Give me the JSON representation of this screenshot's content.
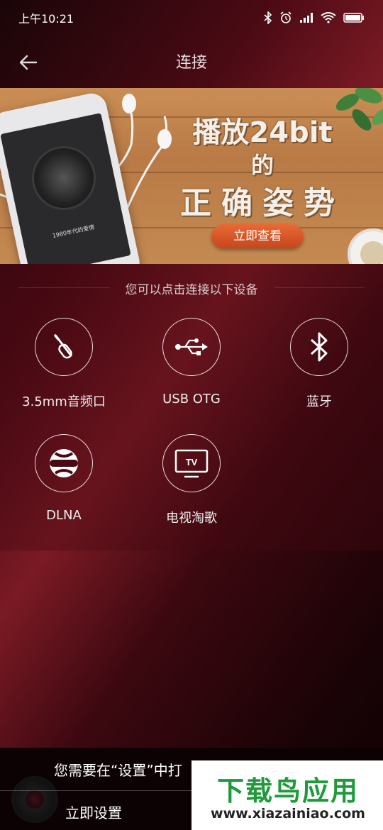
{
  "status_bar": {
    "time": "上午10:21"
  },
  "header": {
    "title": "连接"
  },
  "banner": {
    "line1": "播放24bit",
    "line2": "的",
    "line3": "正确姿势",
    "cta": "立即查看",
    "phone_song": "1980年代的爱情"
  },
  "connect": {
    "hint": "您可以点击连接以下设备",
    "devices": [
      {
        "label": "3.5mm音频口",
        "icon": "audio-jack-icon"
      },
      {
        "label": "USB OTG",
        "icon": "usb-icon"
      },
      {
        "label": "蓝牙",
        "icon": "bluetooth-icon"
      },
      {
        "label": "DLNA",
        "icon": "dlna-icon"
      },
      {
        "label": "电视淘歌",
        "icon": "tv-icon"
      }
    ]
  },
  "bottom": {
    "notice": "您需要在“设置”中打",
    "setup_button": "立即设置"
  },
  "watermark": {
    "title": "下载鸟应用",
    "url": "www.xiazainiao.com"
  }
}
